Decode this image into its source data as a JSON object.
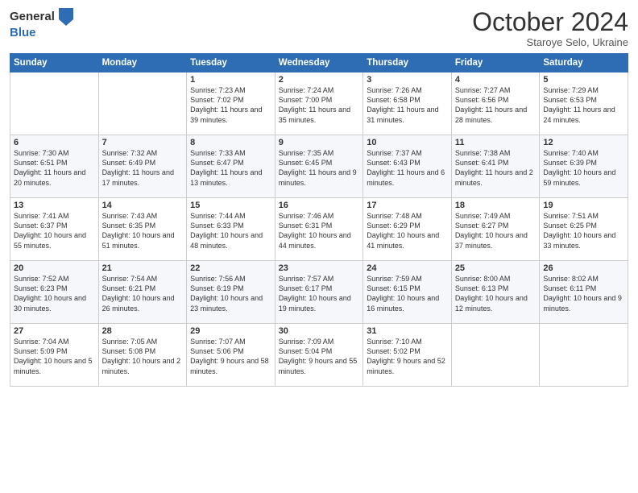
{
  "header": {
    "logo_general": "General",
    "logo_blue": "Blue",
    "month_title": "October 2024",
    "subtitle": "Staroye Selo, Ukraine"
  },
  "days_of_week": [
    "Sunday",
    "Monday",
    "Tuesday",
    "Wednesday",
    "Thursday",
    "Friday",
    "Saturday"
  ],
  "weeks": [
    [
      {
        "day": "",
        "info": ""
      },
      {
        "day": "",
        "info": ""
      },
      {
        "day": "1",
        "info": "Sunrise: 7:23 AM\nSunset: 7:02 PM\nDaylight: 11 hours and 39 minutes."
      },
      {
        "day": "2",
        "info": "Sunrise: 7:24 AM\nSunset: 7:00 PM\nDaylight: 11 hours and 35 minutes."
      },
      {
        "day": "3",
        "info": "Sunrise: 7:26 AM\nSunset: 6:58 PM\nDaylight: 11 hours and 31 minutes."
      },
      {
        "day": "4",
        "info": "Sunrise: 7:27 AM\nSunset: 6:56 PM\nDaylight: 11 hours and 28 minutes."
      },
      {
        "day": "5",
        "info": "Sunrise: 7:29 AM\nSunset: 6:53 PM\nDaylight: 11 hours and 24 minutes."
      }
    ],
    [
      {
        "day": "6",
        "info": "Sunrise: 7:30 AM\nSunset: 6:51 PM\nDaylight: 11 hours and 20 minutes."
      },
      {
        "day": "7",
        "info": "Sunrise: 7:32 AM\nSunset: 6:49 PM\nDaylight: 11 hours and 17 minutes."
      },
      {
        "day": "8",
        "info": "Sunrise: 7:33 AM\nSunset: 6:47 PM\nDaylight: 11 hours and 13 minutes."
      },
      {
        "day": "9",
        "info": "Sunrise: 7:35 AM\nSunset: 6:45 PM\nDaylight: 11 hours and 9 minutes."
      },
      {
        "day": "10",
        "info": "Sunrise: 7:37 AM\nSunset: 6:43 PM\nDaylight: 11 hours and 6 minutes."
      },
      {
        "day": "11",
        "info": "Sunrise: 7:38 AM\nSunset: 6:41 PM\nDaylight: 11 hours and 2 minutes."
      },
      {
        "day": "12",
        "info": "Sunrise: 7:40 AM\nSunset: 6:39 PM\nDaylight: 10 hours and 59 minutes."
      }
    ],
    [
      {
        "day": "13",
        "info": "Sunrise: 7:41 AM\nSunset: 6:37 PM\nDaylight: 10 hours and 55 minutes."
      },
      {
        "day": "14",
        "info": "Sunrise: 7:43 AM\nSunset: 6:35 PM\nDaylight: 10 hours and 51 minutes."
      },
      {
        "day": "15",
        "info": "Sunrise: 7:44 AM\nSunset: 6:33 PM\nDaylight: 10 hours and 48 minutes."
      },
      {
        "day": "16",
        "info": "Sunrise: 7:46 AM\nSunset: 6:31 PM\nDaylight: 10 hours and 44 minutes."
      },
      {
        "day": "17",
        "info": "Sunrise: 7:48 AM\nSunset: 6:29 PM\nDaylight: 10 hours and 41 minutes."
      },
      {
        "day": "18",
        "info": "Sunrise: 7:49 AM\nSunset: 6:27 PM\nDaylight: 10 hours and 37 minutes."
      },
      {
        "day": "19",
        "info": "Sunrise: 7:51 AM\nSunset: 6:25 PM\nDaylight: 10 hours and 33 minutes."
      }
    ],
    [
      {
        "day": "20",
        "info": "Sunrise: 7:52 AM\nSunset: 6:23 PM\nDaylight: 10 hours and 30 minutes."
      },
      {
        "day": "21",
        "info": "Sunrise: 7:54 AM\nSunset: 6:21 PM\nDaylight: 10 hours and 26 minutes."
      },
      {
        "day": "22",
        "info": "Sunrise: 7:56 AM\nSunset: 6:19 PM\nDaylight: 10 hours and 23 minutes."
      },
      {
        "day": "23",
        "info": "Sunrise: 7:57 AM\nSunset: 6:17 PM\nDaylight: 10 hours and 19 minutes."
      },
      {
        "day": "24",
        "info": "Sunrise: 7:59 AM\nSunset: 6:15 PM\nDaylight: 10 hours and 16 minutes."
      },
      {
        "day": "25",
        "info": "Sunrise: 8:00 AM\nSunset: 6:13 PM\nDaylight: 10 hours and 12 minutes."
      },
      {
        "day": "26",
        "info": "Sunrise: 8:02 AM\nSunset: 6:11 PM\nDaylight: 10 hours and 9 minutes."
      }
    ],
    [
      {
        "day": "27",
        "info": "Sunrise: 7:04 AM\nSunset: 5:09 PM\nDaylight: 10 hours and 5 minutes."
      },
      {
        "day": "28",
        "info": "Sunrise: 7:05 AM\nSunset: 5:08 PM\nDaylight: 10 hours and 2 minutes."
      },
      {
        "day": "29",
        "info": "Sunrise: 7:07 AM\nSunset: 5:06 PM\nDaylight: 9 hours and 58 minutes."
      },
      {
        "day": "30",
        "info": "Sunrise: 7:09 AM\nSunset: 5:04 PM\nDaylight: 9 hours and 55 minutes."
      },
      {
        "day": "31",
        "info": "Sunrise: 7:10 AM\nSunset: 5:02 PM\nDaylight: 9 hours and 52 minutes."
      },
      {
        "day": "",
        "info": ""
      },
      {
        "day": "",
        "info": ""
      }
    ]
  ]
}
